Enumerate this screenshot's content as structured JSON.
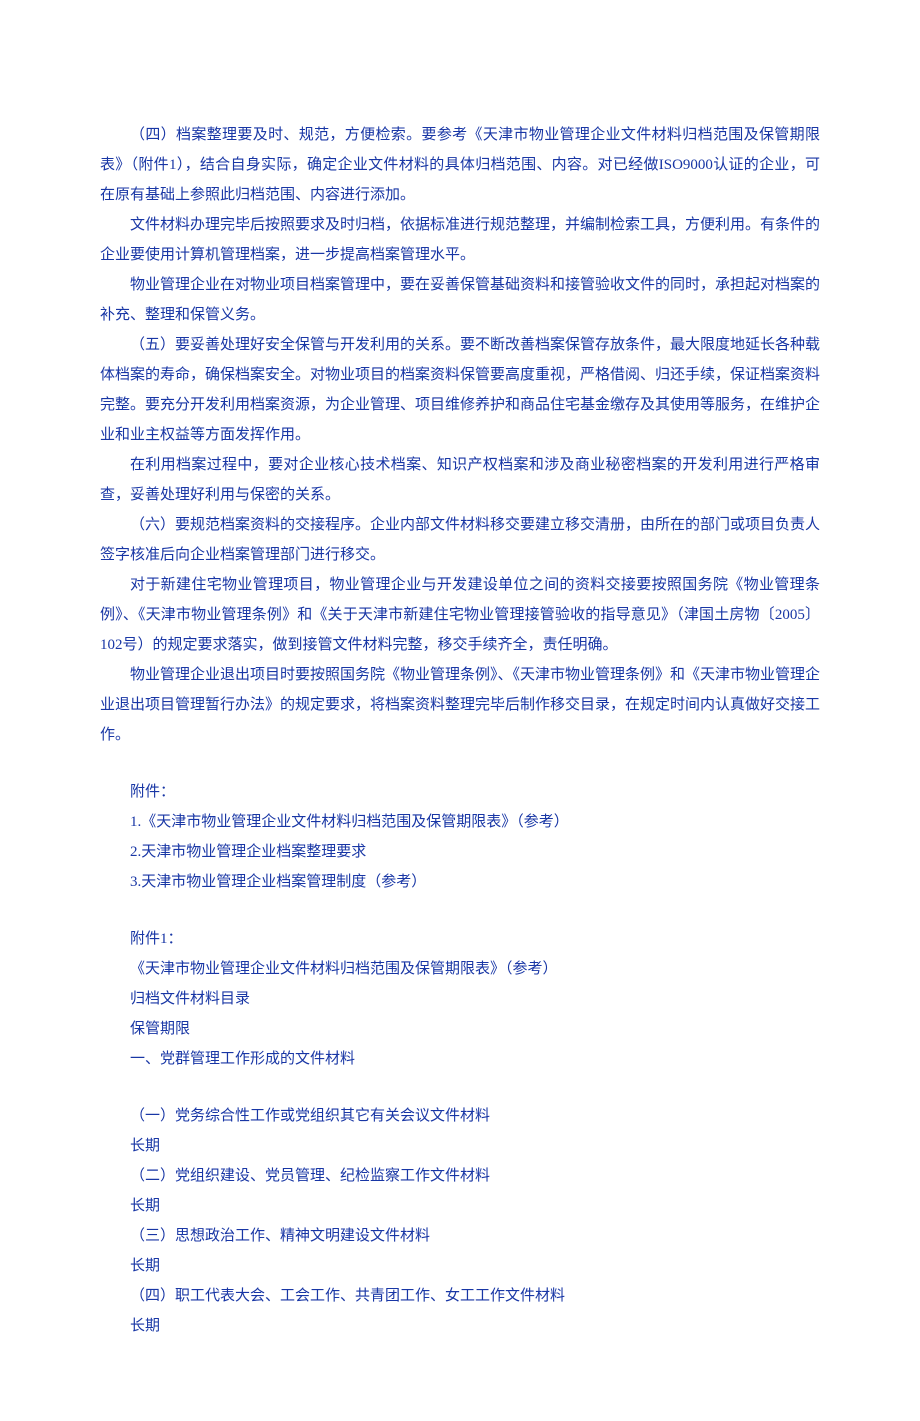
{
  "paragraphs": {
    "p1": "（四）档案整理要及时、规范，方便检索。要参考《天津市物业管理企业文件材料归档范围及保管期限表》（附件1），结合自身实际，确定企业文件材料的具体归档范围、内容。对已经做ISO9000认证的企业，可在原有基础上参照此归档范围、内容进行添加。",
    "p2": "文件材料办理完毕后按照要求及时归档，依据标准进行规范整理，并编制检索工具，方便利用。有条件的企业要使用计算机管理档案，进一步提高档案管理水平。",
    "p3": "物业管理企业在对物业项目档案管理中，要在妥善保管基础资料和接管验收文件的同时，承担起对档案的补充、整理和保管义务。",
    "p4": "（五）要妥善处理好安全保管与开发利用的关系。要不断改善档案保管存放条件，最大限度地延长各种载体档案的寿命，确保档案安全。对物业项目的档案资料保管要高度重视，严格借阅、归还手续，保证档案资料完整。要充分开发利用档案资源，为企业管理、项目维修养护和商品住宅基金缴存及其使用等服务，在维护企业和业主权益等方面发挥作用。",
    "p5": "在利用档案过程中，要对企业核心技术档案、知识产权档案和涉及商业秘密档案的开发利用进行严格审查，妥善处理好利用与保密的关系。",
    "p6": "（六）要规范档案资料的交接程序。企业内部文件材料移交要建立移交清册，由所在的部门或项目负责人签字核准后向企业档案管理部门进行移交。",
    "p7": "对于新建住宅物业管理项目，物业管理企业与开发建设单位之间的资料交接要按照国务院《物业管理条例》、《天津市物业管理条例》和《关于天津市新建住宅物业管理接管验收的指导意见》（津国土房物〔2005〕102号）的规定要求落实，做到接管文件材料完整，移交手续齐全，责任明确。",
    "p8": "物业管理企业退出项目时要按照国务院《物业管理条例》、《天津市物业管理条例》和《天津市物业管理企业退出项目管理暂行办法》的规定要求，将档案资料整理完毕后制作移交目录，在规定时间内认真做好交接工作。"
  },
  "attachments": {
    "heading": "附件：",
    "a1": "1.《天津市物业管理企业文件材料归档范围及保管期限表》（参考）",
    "a2": "2.天津市物业管理企业档案整理要求",
    "a3": "3.天津市物业管理企业档案管理制度（参考）"
  },
  "annex1": {
    "heading": "附件1：",
    "title": "《天津市物业管理企业文件材料归档范围及保管期限表》（参考）",
    "sub1": "归档文件材料目录",
    "sub2": "保管期限",
    "section": "一、党群管理工作形成的文件材料"
  },
  "items": {
    "i1": "（一）党务综合性工作或党组织其它有关会议文件材料",
    "i1p": "长期",
    "i2": "（二）党组织建设、党员管理、纪检监察工作文件材料",
    "i2p": "长期",
    "i3": "（三）思想政治工作、精神文明建设文件材料",
    "i3p": "长期",
    "i4": "（四）职工代表大会、工会工作、共青团工作、女工工作文件材料",
    "i4p": "长期"
  }
}
